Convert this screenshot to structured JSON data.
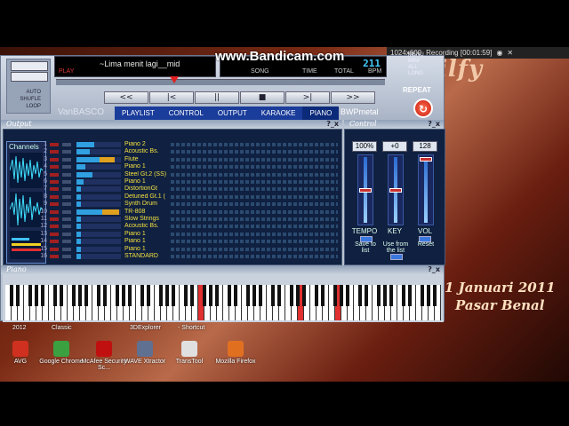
{
  "watermark": "www.Bandicam.com",
  "recorder": {
    "resolution": "1024x600",
    "status": "Recording [00:01:59]"
  },
  "desktop": {
    "title_text": "ilfy",
    "date_text": "1 Januari 2011",
    "place_text": "Pasar Benal"
  },
  "player": {
    "song_title": "~Lima  menit lagi__mid",
    "play_state": "PLAY",
    "song_label": "SONG",
    "time_label": "TIME",
    "total_label": "TOTAL",
    "bpm_label": "BPM",
    "bpm_value": "211",
    "brand": "VanBASCO",
    "skin": "BWPmetal",
    "modes": {
      "auto": "AUTO",
      "shuffle": "SHUFLE",
      "loop": "LOOP"
    },
    "transport": [
      "<<",
      "|<",
      "||",
      "■",
      ">|",
      ">>"
    ],
    "tabs": [
      "PLAYLIST",
      "CONTROL",
      "OUTPUT",
      "KARAOKE",
      "PIANO"
    ],
    "active_tab": "PIANO",
    "repeat_label": "REPEAT",
    "side_menu": [
      "MENU",
      "MINI",
      "ALL",
      "LONG"
    ],
    "seek_position": 0.35
  },
  "output": {
    "header": "Output",
    "channels_label": "Channels",
    "channels": [
      {
        "num": "1",
        "inst": "Piano 2",
        "level": 0.4
      },
      {
        "num": "2",
        "inst": "Acoustic Bs.",
        "level": 0.3
      },
      {
        "num": "3",
        "inst": "Flute",
        "level": 0.85
      },
      {
        "num": "4",
        "inst": "Piano 1",
        "level": 0.2
      },
      {
        "num": "5",
        "inst": "Steel Gt.2 (SS)",
        "level": 0.35
      },
      {
        "num": "6",
        "inst": "Piano 1",
        "level": 0.15
      },
      {
        "num": "7",
        "inst": "DistortionGt",
        "level": 0.1
      },
      {
        "num": "8",
        "inst": "Detuned Gt.1 (",
        "level": 0.1
      },
      {
        "num": "9",
        "inst": "Synth Drum",
        "level": 0.1
      },
      {
        "num": "10",
        "inst": "TR-808",
        "level": 0.95
      },
      {
        "num": "11",
        "inst": "Slow Strings",
        "level": 0.1
      },
      {
        "num": "12",
        "inst": "Acoustic Bs.",
        "level": 0.1
      },
      {
        "num": "13",
        "inst": "Piano 1",
        "level": 0.1
      },
      {
        "num": "14",
        "inst": "Piano 1",
        "level": 0.1
      },
      {
        "num": "15",
        "inst": "Piano 1",
        "level": 0.1
      },
      {
        "num": "16",
        "inst": "STANDARD",
        "level": 0.1
      }
    ]
  },
  "control": {
    "header": "Control",
    "tempo": "100%",
    "key": "+0",
    "vol": "128",
    "tempo_label": "TEMPO",
    "key_label": "KEY",
    "vol_label": "VOL",
    "tempo_level": 0.5,
    "key_level": 0.5,
    "vol_level": 1.0,
    "save_label": "Save to list",
    "use_label": "Use from the list",
    "reset_label": "Reset"
  },
  "piano": {
    "header": "Piano",
    "pressed_keys": [
      31,
      47,
      53
    ]
  },
  "desktop_icons": [
    {
      "label": "AVG",
      "color": "#d03020"
    },
    {
      "label": "Google Chrome",
      "color": "#3aa040"
    },
    {
      "label": "McAfee Security Sc...",
      "color": "#c01010"
    },
    {
      "label": "WAVE Xtractor",
      "color": "#607090"
    },
    {
      "label": "TransTool",
      "color": "#e0e0e0"
    },
    {
      "label": "Mozilla Firefox",
      "color": "#e07020"
    }
  ],
  "desktop_top_labels": [
    "2012",
    "Classic",
    "3DExplorer",
    "- Shortcut"
  ]
}
